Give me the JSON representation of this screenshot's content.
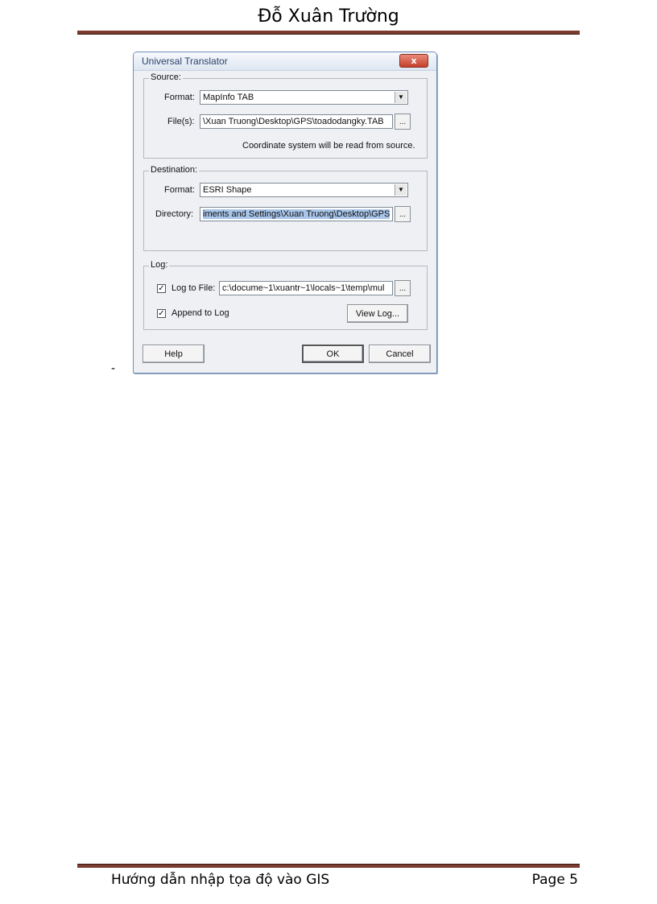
{
  "page": {
    "header_title": "Đỗ Xuân Trường",
    "footer_left": "Hướng dẫn nhập tọa độ vào GIS",
    "footer_right": "Page 5",
    "dash": "-"
  },
  "dialog": {
    "title": "Universal Translator",
    "close_glyph": "x",
    "source": {
      "group_label": "Source:",
      "format_label": "Format:",
      "format_value": "MapInfo TAB",
      "files_label": "File(s):",
      "files_value": "\\Xuan Truong\\Desktop\\GPS\\toadodangky.TAB",
      "browse_label": "...",
      "note": "Coordinate system will be read from source."
    },
    "destination": {
      "group_label": "Destination:",
      "format_label": "Format:",
      "format_value": "ESRI Shape",
      "directory_label": "Directory:",
      "directory_value": "iments and Settings\\Xuan Truong\\Desktop\\GPS",
      "browse_label": "..."
    },
    "log": {
      "group_label": "Log:",
      "log_to_file_label": "Log to File:",
      "log_to_file_checked": true,
      "log_file_value": "c:\\docume~1\\xuantr~1\\locals~1\\temp\\mul",
      "browse_label": "...",
      "append_label": "Append to Log",
      "append_checked": true,
      "view_log_label": "View Log..."
    },
    "buttons": {
      "help": "Help",
      "ok": "OK",
      "cancel": "Cancel"
    },
    "check_glyph": "✓",
    "dropdown_glyph": "▼"
  }
}
